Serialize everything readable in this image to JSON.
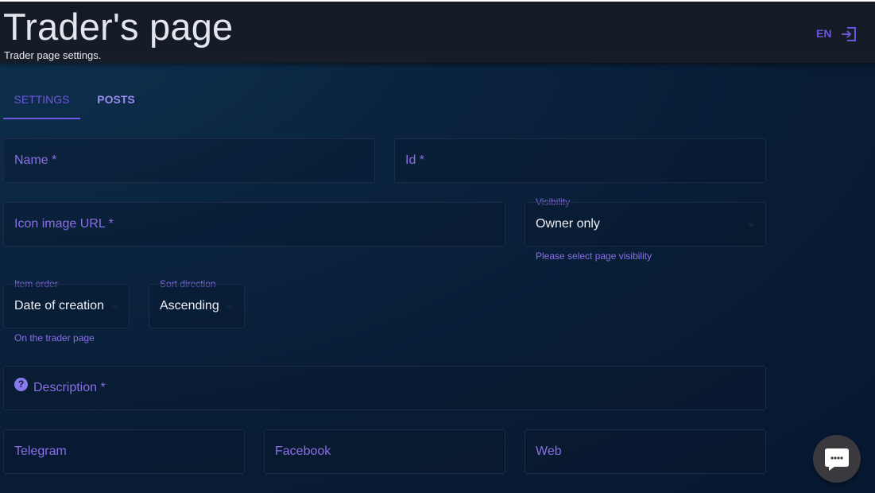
{
  "header": {
    "title": "Trader's page",
    "subtitle": "Trader page settings.",
    "language": "EN",
    "logout_icon": "logout-icon"
  },
  "tabs": [
    {
      "label": "SETTINGS",
      "active": true
    },
    {
      "label": "POSTS",
      "active": false
    }
  ],
  "form": {
    "name": {
      "label": "Name *",
      "value": ""
    },
    "id": {
      "label": "Id *",
      "value": ""
    },
    "icon_url": {
      "label": "Icon image URL *",
      "value": ""
    },
    "visibility": {
      "label": "Visibility",
      "value": "Owner only",
      "helper": "Please select page visibility"
    },
    "item_order": {
      "label": "Item order",
      "value": "Date of creation",
      "helper": "On the trader page"
    },
    "sort_direction": {
      "label": "Sort direction",
      "value": "Ascending"
    },
    "description": {
      "label": "Description *",
      "help_icon": "question-icon",
      "help_glyph": "?"
    },
    "telegram": {
      "label": "Telegram",
      "value": ""
    },
    "facebook": {
      "label": "Facebook",
      "value": ""
    },
    "web": {
      "label": "Web",
      "value": ""
    }
  },
  "chat": {
    "icon": "chat-icon"
  },
  "colors": {
    "accent": "#6f58e0",
    "label": "#8a6fe6",
    "background": "#0a2440",
    "header": "#161d28"
  }
}
